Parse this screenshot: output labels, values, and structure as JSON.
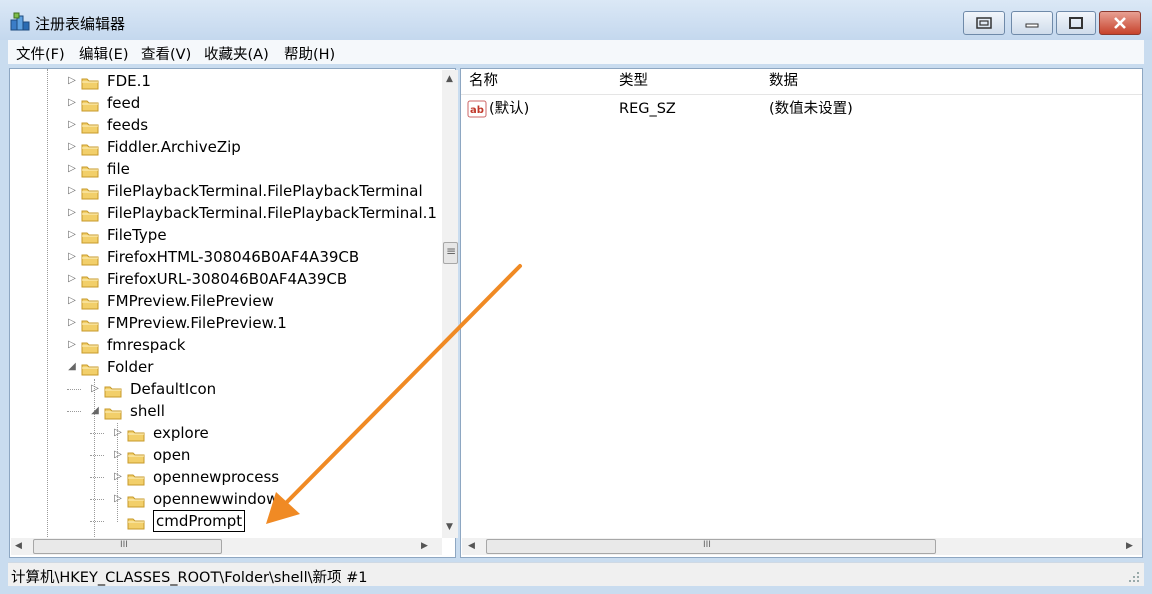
{
  "window": {
    "title": "注册表编辑器"
  },
  "menu": [
    "文件(F)",
    "编辑(E)",
    "查看(V)",
    "收藏夹(A)",
    "帮助(H)"
  ],
  "tree": {
    "items": [
      {
        "label": "FDE.1",
        "depth": 0,
        "expanded": false,
        "selected": false
      },
      {
        "label": "feed",
        "depth": 0,
        "expanded": false,
        "selected": false
      },
      {
        "label": "feeds",
        "depth": 0,
        "expanded": false,
        "selected": false
      },
      {
        "label": "Fiddler.ArchiveZip",
        "depth": 0,
        "expanded": false,
        "selected": false
      },
      {
        "label": "file",
        "depth": 0,
        "expanded": false,
        "selected": false
      },
      {
        "label": "FilePlaybackTerminal.FilePlaybackTerminal",
        "depth": 0,
        "expanded": false,
        "selected": false
      },
      {
        "label": "FilePlaybackTerminal.FilePlaybackTerminal.1",
        "depth": 0,
        "expanded": false,
        "selected": false
      },
      {
        "label": "FileType",
        "depth": 0,
        "expanded": false,
        "selected": false
      },
      {
        "label": "FirefoxHTML-308046B0AF4A39CB",
        "depth": 0,
        "expanded": false,
        "selected": false
      },
      {
        "label": "FirefoxURL-308046B0AF4A39CB",
        "depth": 0,
        "expanded": false,
        "selected": false
      },
      {
        "label": "FMPreview.FilePreview",
        "depth": 0,
        "expanded": false,
        "selected": false
      },
      {
        "label": "FMPreview.FilePreview.1",
        "depth": 0,
        "expanded": false,
        "selected": false
      },
      {
        "label": "fmrespack",
        "depth": 0,
        "expanded": false,
        "selected": false
      },
      {
        "label": "Folder",
        "depth": 0,
        "expanded": true,
        "selected": false
      },
      {
        "label": "DefaultIcon",
        "depth": 1,
        "expanded": false,
        "selected": false
      },
      {
        "label": "shell",
        "depth": 1,
        "expanded": true,
        "selected": false
      },
      {
        "label": "explore",
        "depth": 2,
        "expanded": false,
        "selected": false
      },
      {
        "label": "open",
        "depth": 2,
        "expanded": false,
        "selected": false
      },
      {
        "label": "opennewprocess",
        "depth": 2,
        "expanded": false,
        "selected": false
      },
      {
        "label": "opennewwindow",
        "depth": 2,
        "expanded": false,
        "selected": false
      },
      {
        "label": "cmdPrompt",
        "depth": 2,
        "expanded": false,
        "selected": true,
        "editing": true
      }
    ]
  },
  "list": {
    "headers": [
      "名称",
      "类型",
      "数据"
    ],
    "rows": [
      {
        "name": "(默认)",
        "type": "REG_SZ",
        "data": "(数值未设置)",
        "icon": "string-value-icon"
      }
    ]
  },
  "status": "计算机\\HKEY_CLASSES_ROOT\\Folder\\shell\\新项 #1",
  "scroll": {
    "scroll_left": "◀",
    "scroll_right": "▶",
    "scroll_up": "▲",
    "scroll_down": "▼",
    "grip": "III",
    "vgrip": "≡"
  },
  "colors": {
    "annotation_arrow": "#f08a24",
    "folder": "#e8c35a"
  }
}
